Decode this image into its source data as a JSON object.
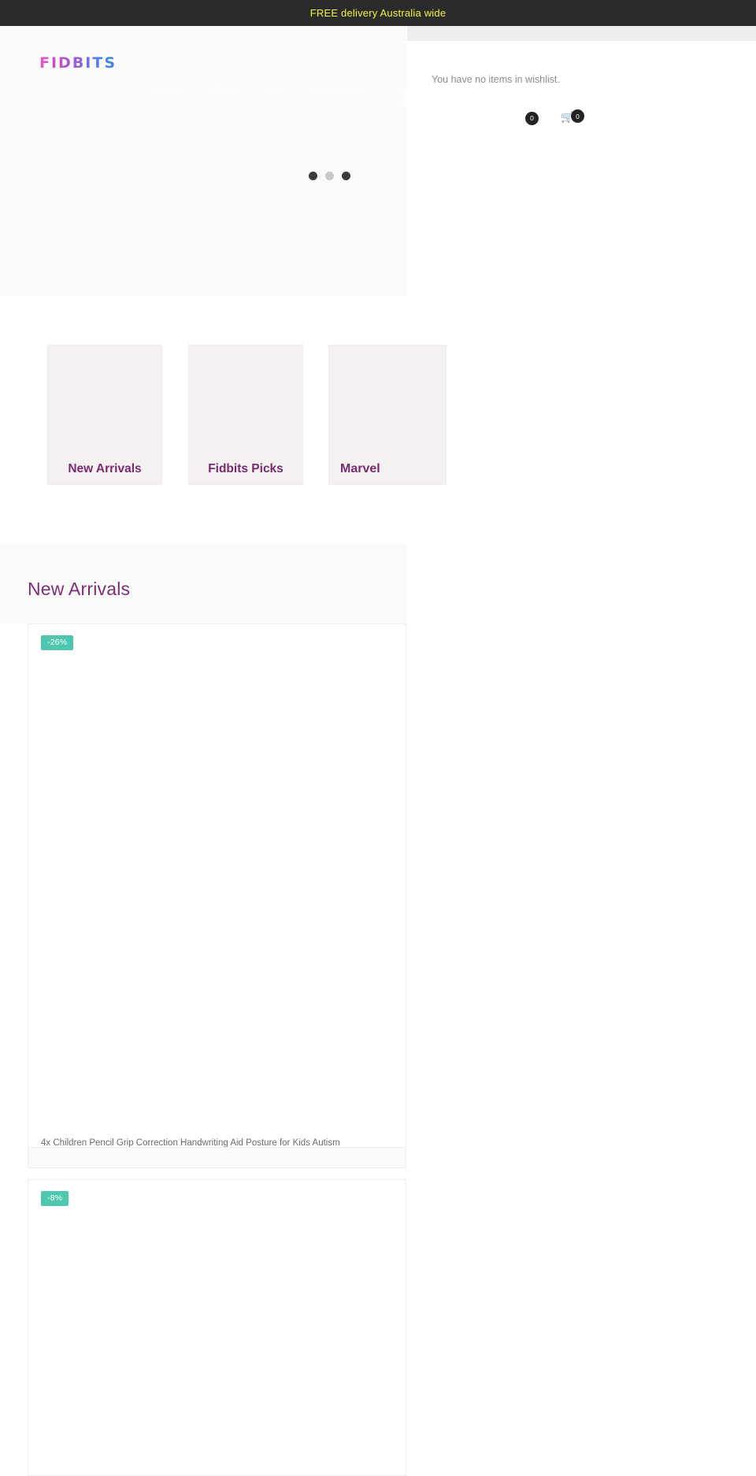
{
  "announcement": {
    "text": "FREE delivery Australia wide",
    "bg": "#2b2b2b",
    "color": "#f2f542"
  },
  "header": {
    "logo_text": "FIDBITS",
    "logo_gradient_from": "#e05fc8",
    "logo_gradient_to": "#3f7fe0",
    "nav": [
      {
        "label": "Home"
      },
      {
        "label": "Shop"
      },
      {
        "label": "Blog"
      },
      {
        "label": "Community"
      },
      {
        "label": "Our Story"
      }
    ]
  },
  "carousel": {
    "dots": [
      {
        "state": "active"
      },
      {
        "state": "inactive"
      },
      {
        "state": "active"
      }
    ]
  },
  "wishlist_panel": {
    "empty_message": "You have no items in wishlist.",
    "wishlist_count": "0",
    "cart_count": "0",
    "cart_icon": "cart-icon"
  },
  "categories": [
    {
      "label": "New Arrivals"
    },
    {
      "label": "Fidbits Picks"
    },
    {
      "label": "Marvel"
    }
  ],
  "new_arrivals": {
    "heading": "New Arrivals",
    "heading_color": "#7c2d78",
    "products": [
      {
        "discount": "-26%",
        "title": "4x Children Pencil Grip Correction Handwriting Aid Posture for Kids Autism",
        "badge_color": "#4ec7ae"
      },
      {
        "discount": "-8%",
        "title": "",
        "badge_color": "#4ec7ae"
      }
    ]
  }
}
